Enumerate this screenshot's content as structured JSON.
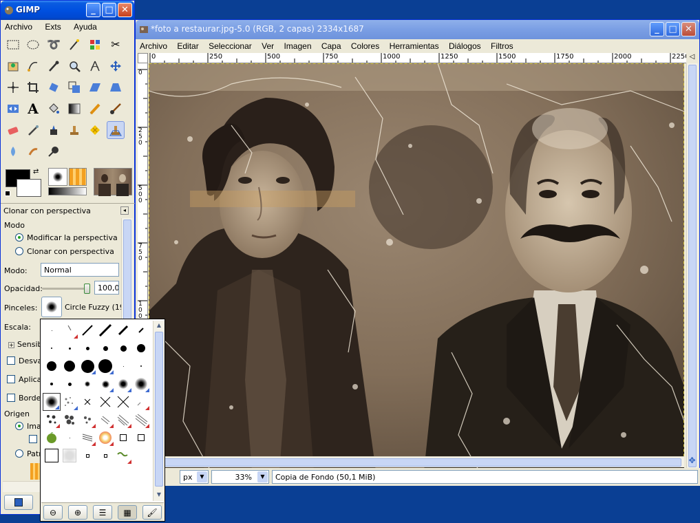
{
  "toolbox": {
    "title": "GIMP",
    "menu": [
      "Archivo",
      "Exts",
      "Ayuda"
    ],
    "options_title": "Clonar con perspectiva",
    "options": {
      "modo_label": "Modo",
      "mode_option_1": "Modificar la perspectiva",
      "mode_option_2": "Clonar con perspectiva",
      "mode_select_label": "Modo:",
      "mode_select_value": "Normal",
      "opacity_label": "Opacidad:",
      "opacity_value": "100,0",
      "brush_label": "Pinceles:",
      "brush_name": "Circle Fuzzy (19",
      "scale_label": "Escala:",
      "sensibility_label": "Sensibi",
      "fade_label": "Desva",
      "apply_label": "Aplicar",
      "hard_edge_label": "Bordes",
      "source_label": "Origen",
      "source_image_label": "Imag",
      "source_pattern_label": "Patr"
    }
  },
  "image_window": {
    "title": "*foto a restaurar.jpg-5.0 (RGB, 2 capas) 2334x1687",
    "menu": [
      "Archivo",
      "Editar",
      "Seleccionar",
      "Ver",
      "Imagen",
      "Capa",
      "Colores",
      "Herramientas",
      "Diálogos",
      "Filtros"
    ],
    "ruler_h_ticks": [
      "0",
      "250",
      "500",
      "750",
      "1000",
      "1250",
      "1500",
      "1750",
      "2000",
      "2250"
    ],
    "ruler_v_ticks": [
      "0",
      "250",
      "500",
      "750",
      "1000"
    ],
    "unit": "px",
    "zoom": "33%",
    "status": "Copia de Fondo (50,1 MiB)"
  },
  "colors": {
    "xp_blue": "#0a3f94",
    "xp_face": "#ece9d8",
    "photo_sepia": "#8a7560"
  }
}
